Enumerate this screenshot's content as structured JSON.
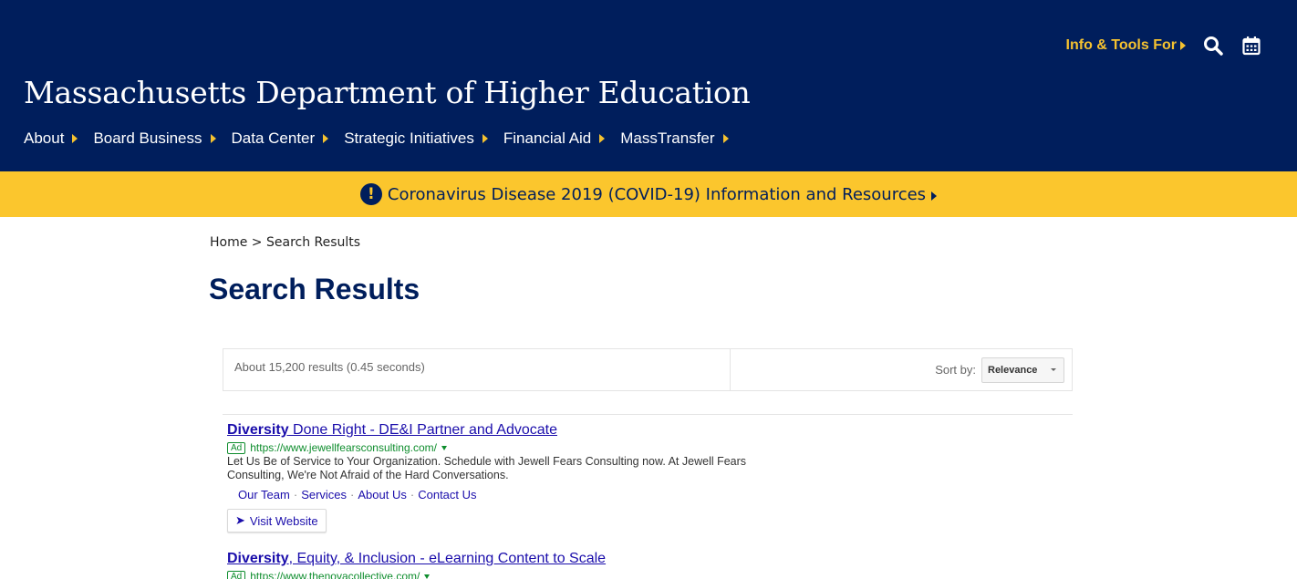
{
  "header": {
    "site_title": "Massachusetts Department of Higher Education",
    "info_tools_label": "Info & Tools For",
    "nav": [
      {
        "label": "About"
      },
      {
        "label": "Board Business"
      },
      {
        "label": "Data Center"
      },
      {
        "label": "Strategic Initiatives"
      },
      {
        "label": "Financial Aid"
      },
      {
        "label": "MassTransfer"
      }
    ]
  },
  "alert": {
    "icon_text": "!",
    "text": "Coronavirus Disease 2019 (COVID-19) Information and Resources"
  },
  "breadcrumb": {
    "home": "Home",
    "separator": " > ",
    "current": "Search Results"
  },
  "page_title": "Search Results",
  "results": {
    "count_text": "About 15,200 results (0.45 seconds)",
    "sort_label": "Sort by:",
    "sort_value": "Relevance"
  },
  "ads": [
    {
      "title_bold": "Diversity",
      "title_rest": " Done Right - DE&I Partner and Advocate",
      "badge": "Ad",
      "url": "https://www.jewellfearsconsulting.com/",
      "description": "Let Us Be of Service to Your Organization. Schedule with Jewell Fears Consulting now. At Jewell Fears Consulting, We're Not Afraid of the Hard Conversations.",
      "sitelinks": [
        "Our Team",
        "Services",
        "About Us",
        "Contact Us"
      ],
      "visit_label": "Visit Website"
    },
    {
      "title_bold": "Diversity",
      "title_rest": ", Equity, & Inclusion - eLearning Content to Scale",
      "badge": "Ad",
      "url": "https://www.thenovacollective.com/"
    }
  ],
  "colors": {
    "header_bg": "#001e5c",
    "accent_gold": "#f5c230",
    "alert_bg": "#fbc62d",
    "link_blue": "#1a0dab",
    "url_green": "#0e8d2d"
  },
  "icons": [
    "search-icon",
    "calendar-icon",
    "exclamation-icon",
    "arrow-right-icon"
  ]
}
